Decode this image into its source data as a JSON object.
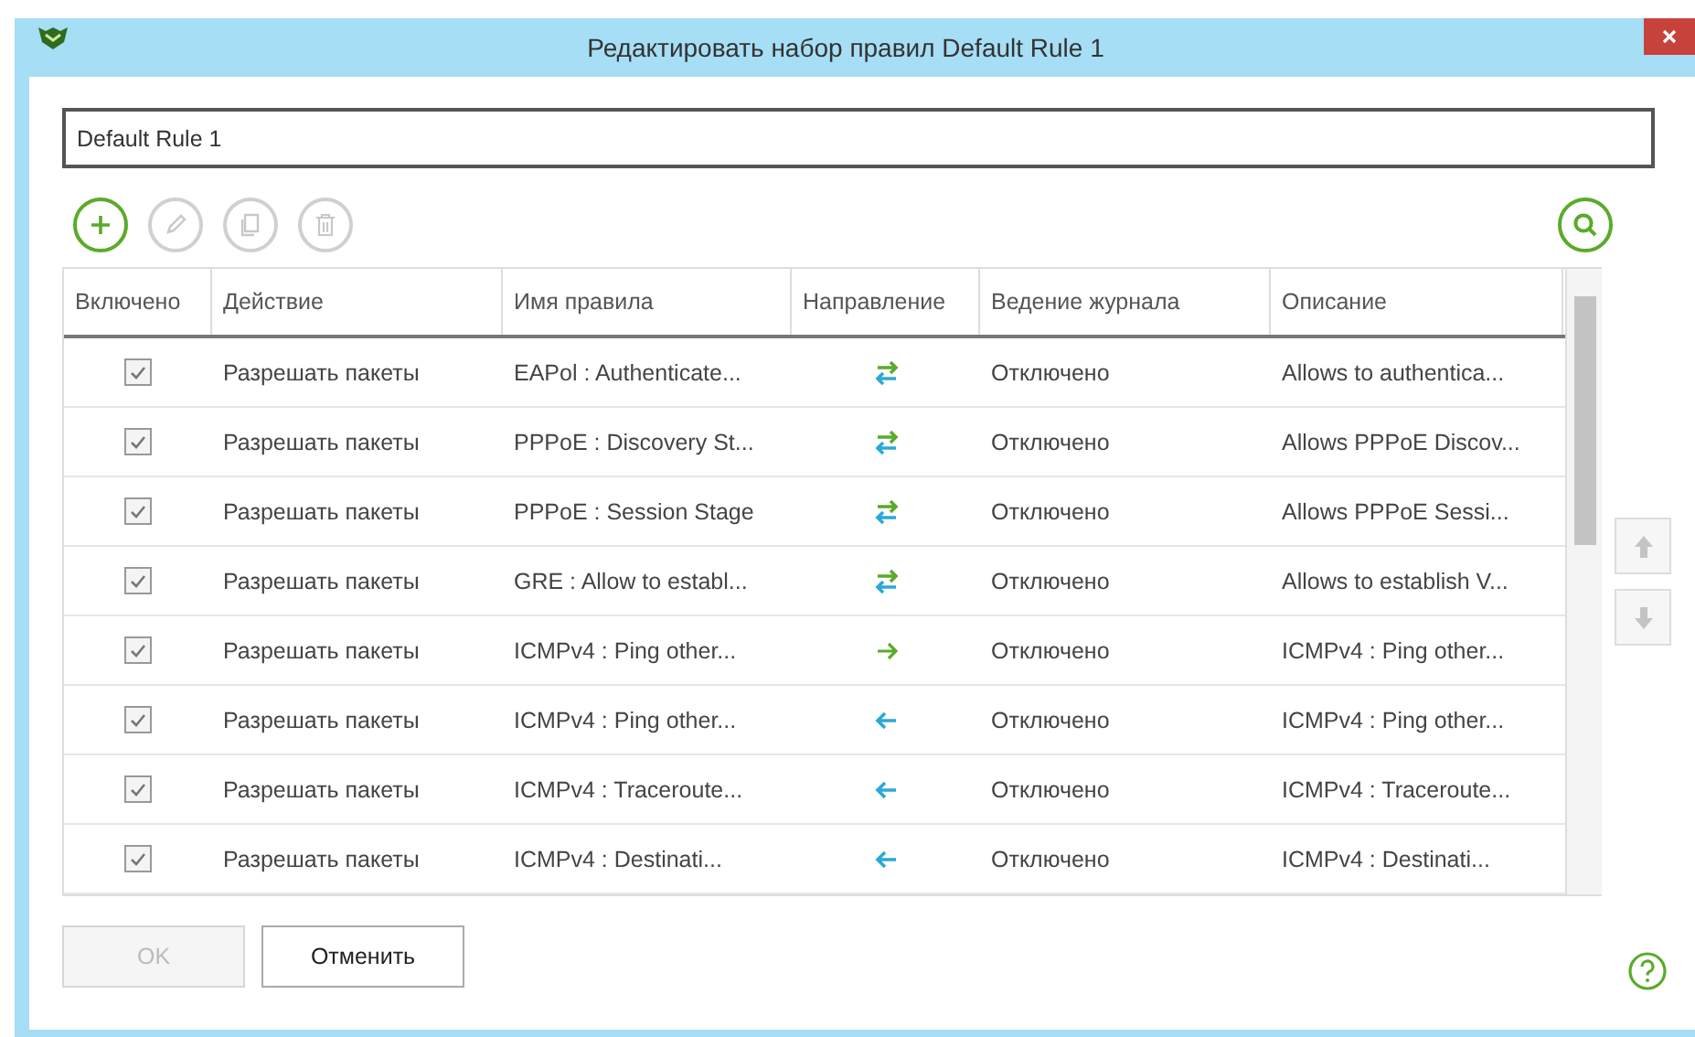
{
  "window": {
    "title": "Редактировать набор правил Default Rule 1"
  },
  "name_field": {
    "value": "Default Rule 1"
  },
  "toolbar": [
    {
      "kind": "add",
      "disabled": false
    },
    {
      "kind": "edit",
      "disabled": true
    },
    {
      "kind": "copy",
      "disabled": true
    },
    {
      "kind": "delete",
      "disabled": true
    }
  ],
  "table": {
    "columns": [
      "Включено",
      "Действие",
      "Имя правила",
      "Направление",
      "Ведение журнала",
      "Описание"
    ],
    "rows": [
      {
        "checked": true,
        "action": "Разрешать пакеты",
        "name": "EAPol : Authenticate...",
        "kind": "both",
        "logging": "Отключено",
        "description": "Allows to authentica..."
      },
      {
        "checked": true,
        "action": "Разрешать пакеты",
        "name": "PPPoE : Discovery St...",
        "kind": "both",
        "logging": "Отключено",
        "description": "Allows PPPoE Discov..."
      },
      {
        "checked": true,
        "action": "Разрешать пакеты",
        "name": "PPPoE : Session Stage",
        "kind": "both",
        "logging": "Отключено",
        "description": "Allows PPPoE Sessi..."
      },
      {
        "checked": true,
        "action": "Разрешать пакеты",
        "name": "GRE : Allow to establ...",
        "kind": "both",
        "logging": "Отключено",
        "description": "Allows to establish V..."
      },
      {
        "checked": true,
        "action": "Разрешать пакеты",
        "name": "ICMPv4 : Ping other...",
        "kind": "out",
        "logging": "Отключено",
        "description": "ICMPv4 : Ping other..."
      },
      {
        "checked": true,
        "action": "Разрешать пакеты",
        "name": "ICMPv4 : Ping other...",
        "kind": "in",
        "logging": "Отключено",
        "description": "ICMPv4 : Ping other..."
      },
      {
        "checked": true,
        "action": "Разрешать пакеты",
        "name": "ICMPv4 : Traceroute...",
        "kind": "in",
        "logging": "Отключено",
        "description": "ICMPv4 : Traceroute..."
      },
      {
        "checked": true,
        "action": "Разрешать пакеты",
        "name": "ICMPv4 : Destinati...",
        "kind": "in",
        "logging": "Отключено",
        "description": "ICMPv4 : Destinati..."
      }
    ]
  },
  "buttons": [
    {
      "label": "OK",
      "disabled": true
    },
    {
      "label": "Отменить",
      "disabled": false
    }
  ]
}
